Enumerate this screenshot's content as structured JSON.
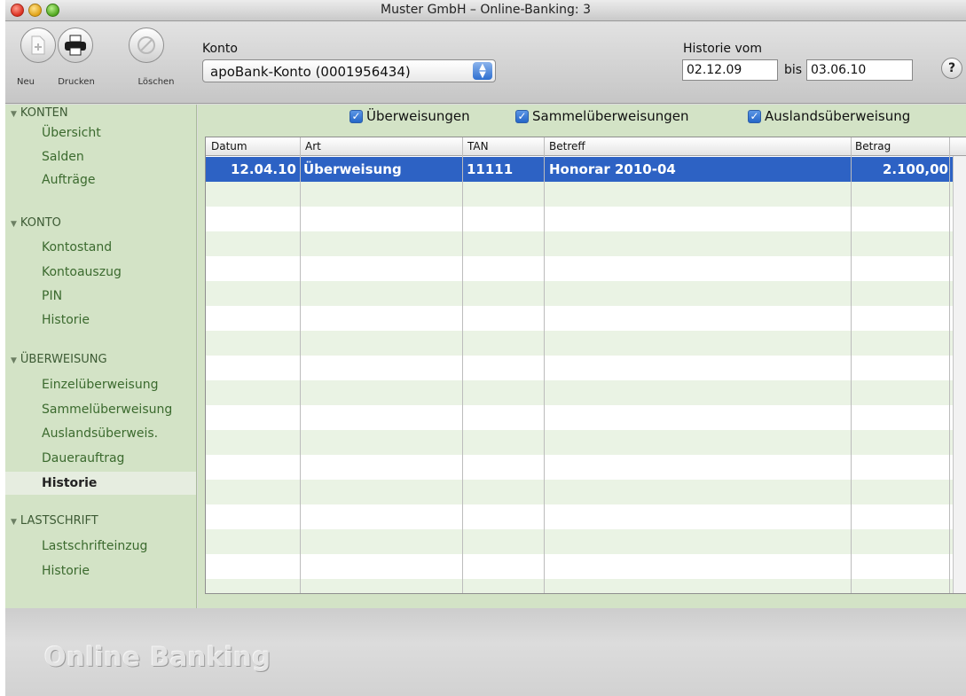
{
  "window": {
    "title": "Muster GmbH – Online-Banking: 3"
  },
  "toolbar": {
    "neu_label": "Neu",
    "drucken_label": "Drucken",
    "loeschen_label": "Löschen",
    "konto_label": "Konto",
    "konto_value": "apoBank-Konto (0001956434)",
    "historie_label": "Historie vom",
    "date_from": "02.12.09",
    "bis_label": "bis",
    "date_to": "03.06.10",
    "help_label": "?"
  },
  "sidebar": {
    "sections": [
      {
        "title": "KONTEN",
        "items": [
          "Übersicht",
          "Salden",
          "Aufträge"
        ]
      },
      {
        "title": "KONTO",
        "items": [
          "Kontostand",
          "Kontoauszug",
          "PIN",
          "Historie"
        ]
      },
      {
        "title": "ÜBERWEISUNG",
        "items": [
          "Einzelüberweisung",
          "Sammelüberweisung",
          "Auslandsüberweis.",
          "Dauerauftrag",
          "Historie"
        ]
      },
      {
        "title": "LASTSCHRIFT",
        "items": [
          "Lastschrifteinzug",
          "Historie"
        ]
      }
    ],
    "active_item": "Historie"
  },
  "filters": [
    {
      "label": "Überweisungen",
      "checked": true
    },
    {
      "label": "Sammelüberweisungen",
      "checked": true
    },
    {
      "label": "Auslandsüberweisung",
      "checked": true
    }
  ],
  "table": {
    "columns": [
      "Datum",
      "Art",
      "TAN",
      "Betreff",
      "Betrag"
    ],
    "rows": [
      {
        "datum": "12.04.10",
        "art": "Überweisung",
        "tan": "11111",
        "betreff": "Honorar 2010-04",
        "betrag": "2.100,00",
        "selected": true
      }
    ]
  },
  "footer": {
    "brand": "Online Banking"
  },
  "colors": {
    "selection": "#2d62c4",
    "sidebar_bg": "#d3e3c6",
    "row_alt": "#eaf3e4"
  }
}
